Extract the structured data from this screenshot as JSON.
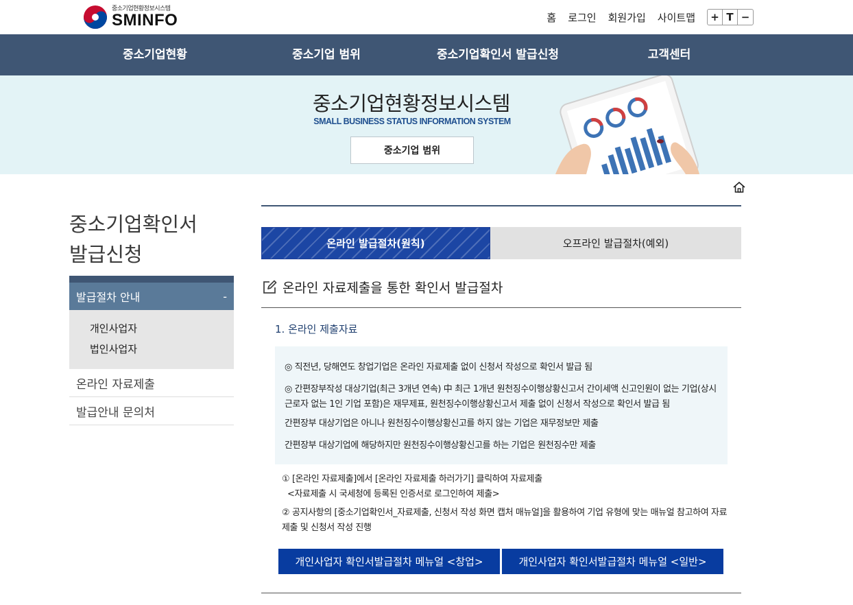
{
  "header": {
    "logo_sub": "중소기업현황정보시스템",
    "logo_main": "SMINFO",
    "util_links": [
      "홈",
      "로그인",
      "회원가입",
      "사이트맵"
    ],
    "font_controls": [
      "+",
      "T",
      "−"
    ]
  },
  "gnb": [
    "중소기업현황",
    "중소기업 범위",
    "중소기업확인서 발급신청",
    "고객센터"
  ],
  "banner": {
    "title": "중소기업현황정보시스템",
    "subtitle": "SMALL BUSINESS STATUS INFORMATION SYSTEM",
    "box_label": "중소기업 범위"
  },
  "sidebar": {
    "title_line1": "중소기업확인서",
    "title_line2": "발급신청",
    "active": {
      "label": "발급절차 안내",
      "toggle": "-"
    },
    "sub_items": [
      "개인사업자",
      "법인사업자"
    ],
    "items": [
      "온라인 자료제출",
      "발급안내 문의처"
    ]
  },
  "tabs": {
    "online": "온라인 발급절차(원칙)",
    "offline": "오프라인 발급절차(예외)"
  },
  "section": {
    "title": "온라인 자료제출을 통한 확인서 발급절차",
    "subtitle": "1. 온라인 제출자료"
  },
  "notice": {
    "line1": "◎ 직전년, 당해연도 창업기업은 온라인 자료제출 없이 신청서 작성으로 확인서 발급 됨",
    "line2a": "◎ 간편장부작성 대상기업(최근 3개년 연속) 中 최근 1개년 원천징수이행상황신고서 간이세액 신고인원이 없는 기업(상시",
    "line2b": "근로자 없는 1인 기업 포함)은 재무제표, 원천징수이행상황신고서 제출 없이 신청서 작성으로 확인서 발급 됨",
    "line3": "간편장부 대상기업은 아니나 원천징수이행상황신고를 하지 않는 기업은 재무정보만 제출",
    "line4": "간편장부 대상기업에 해당하지만 원천징수이행상황신고를 하는 기업은 원천징수만 제출"
  },
  "steps": {
    "s1": "① [온라인 자료제출]에서 [온라인 자료제출 하러가기] 클릭하여 자료제출",
    "s1_note": "<자료제출 시 국세청에 등록된 인증서로 로그인하여 제출>",
    "s2a": "② 공지사항의 [중소기업확인서_자료제출, 신청서 작성 화면 캡처 매뉴얼]을 활용하여 기업 유형에 맞는 매뉴얼 참고하여 자료",
    "s2b": "제출 및 신청서 작성 진행"
  },
  "buttons": {
    "manual_startup": "개인사업자 확인서발급절차 메뉴얼 <창업>",
    "manual_general": "개인사업자 확인서발급절차 메뉴얼 <일반>"
  },
  "colors": {
    "nav_bg": "#3f5674",
    "banner_bg": "#e3f3f6",
    "tab_active": "#1c46a4",
    "button_bg": "#083ca0",
    "notice_bg": "#eff6f9"
  }
}
